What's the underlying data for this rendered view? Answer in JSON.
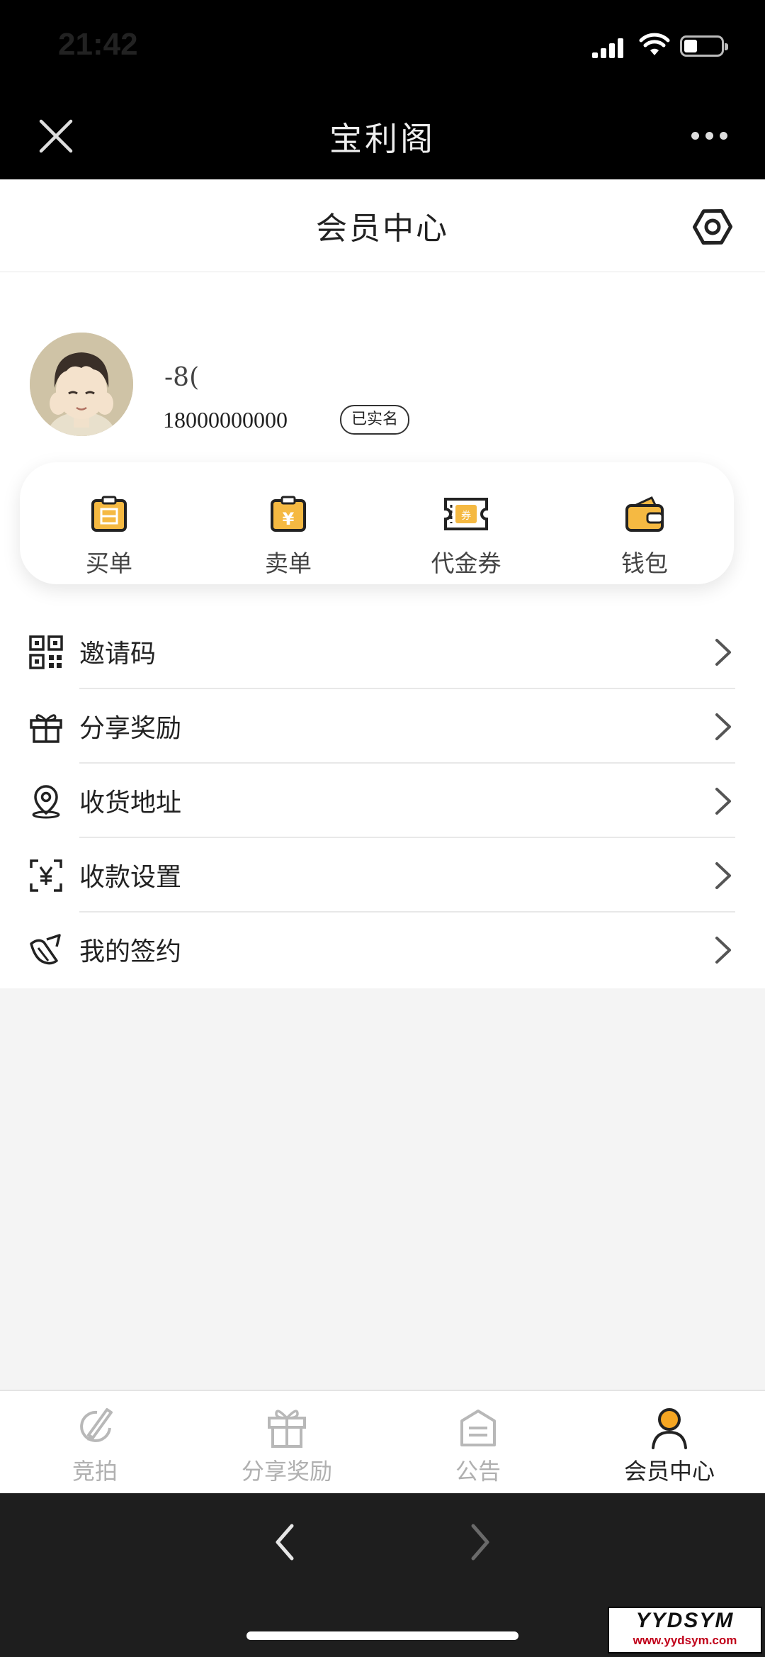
{
  "status": {
    "time": "21:42"
  },
  "nav": {
    "title": "宝利阁"
  },
  "header": {
    "title": "会员中心"
  },
  "profile": {
    "name": "-8(",
    "phone": "18000000000",
    "badge": "已实名"
  },
  "quick_actions": [
    {
      "label": "买单",
      "icon": "buy-order-icon"
    },
    {
      "label": "卖单",
      "icon": "sell-order-icon"
    },
    {
      "label": "代金券",
      "icon": "voucher-icon"
    },
    {
      "label": "钱包",
      "icon": "wallet-icon"
    }
  ],
  "menu": [
    {
      "label": "邀请码",
      "icon": "qr-code-icon"
    },
    {
      "label": "分享奖励",
      "icon": "gift-icon"
    },
    {
      "label": "收货地址",
      "icon": "location-icon"
    },
    {
      "label": "收款设置",
      "icon": "yuan-scan-icon"
    },
    {
      "label": "我的签约",
      "icon": "signature-icon"
    }
  ],
  "tabs": [
    {
      "label": "竞拍",
      "icon": "auction-icon",
      "active": false
    },
    {
      "label": "分享奖励",
      "icon": "gift-icon",
      "active": false
    },
    {
      "label": "公告",
      "icon": "notice-icon",
      "active": false
    },
    {
      "label": "会员中心",
      "icon": "member-icon",
      "active": true
    }
  ],
  "watermark": {
    "main": "YYDSYM",
    "sub": "www.yydsym.com"
  },
  "colors": {
    "accent": "#f5a623",
    "dark": "#000000",
    "background": "#f4f4f4"
  }
}
